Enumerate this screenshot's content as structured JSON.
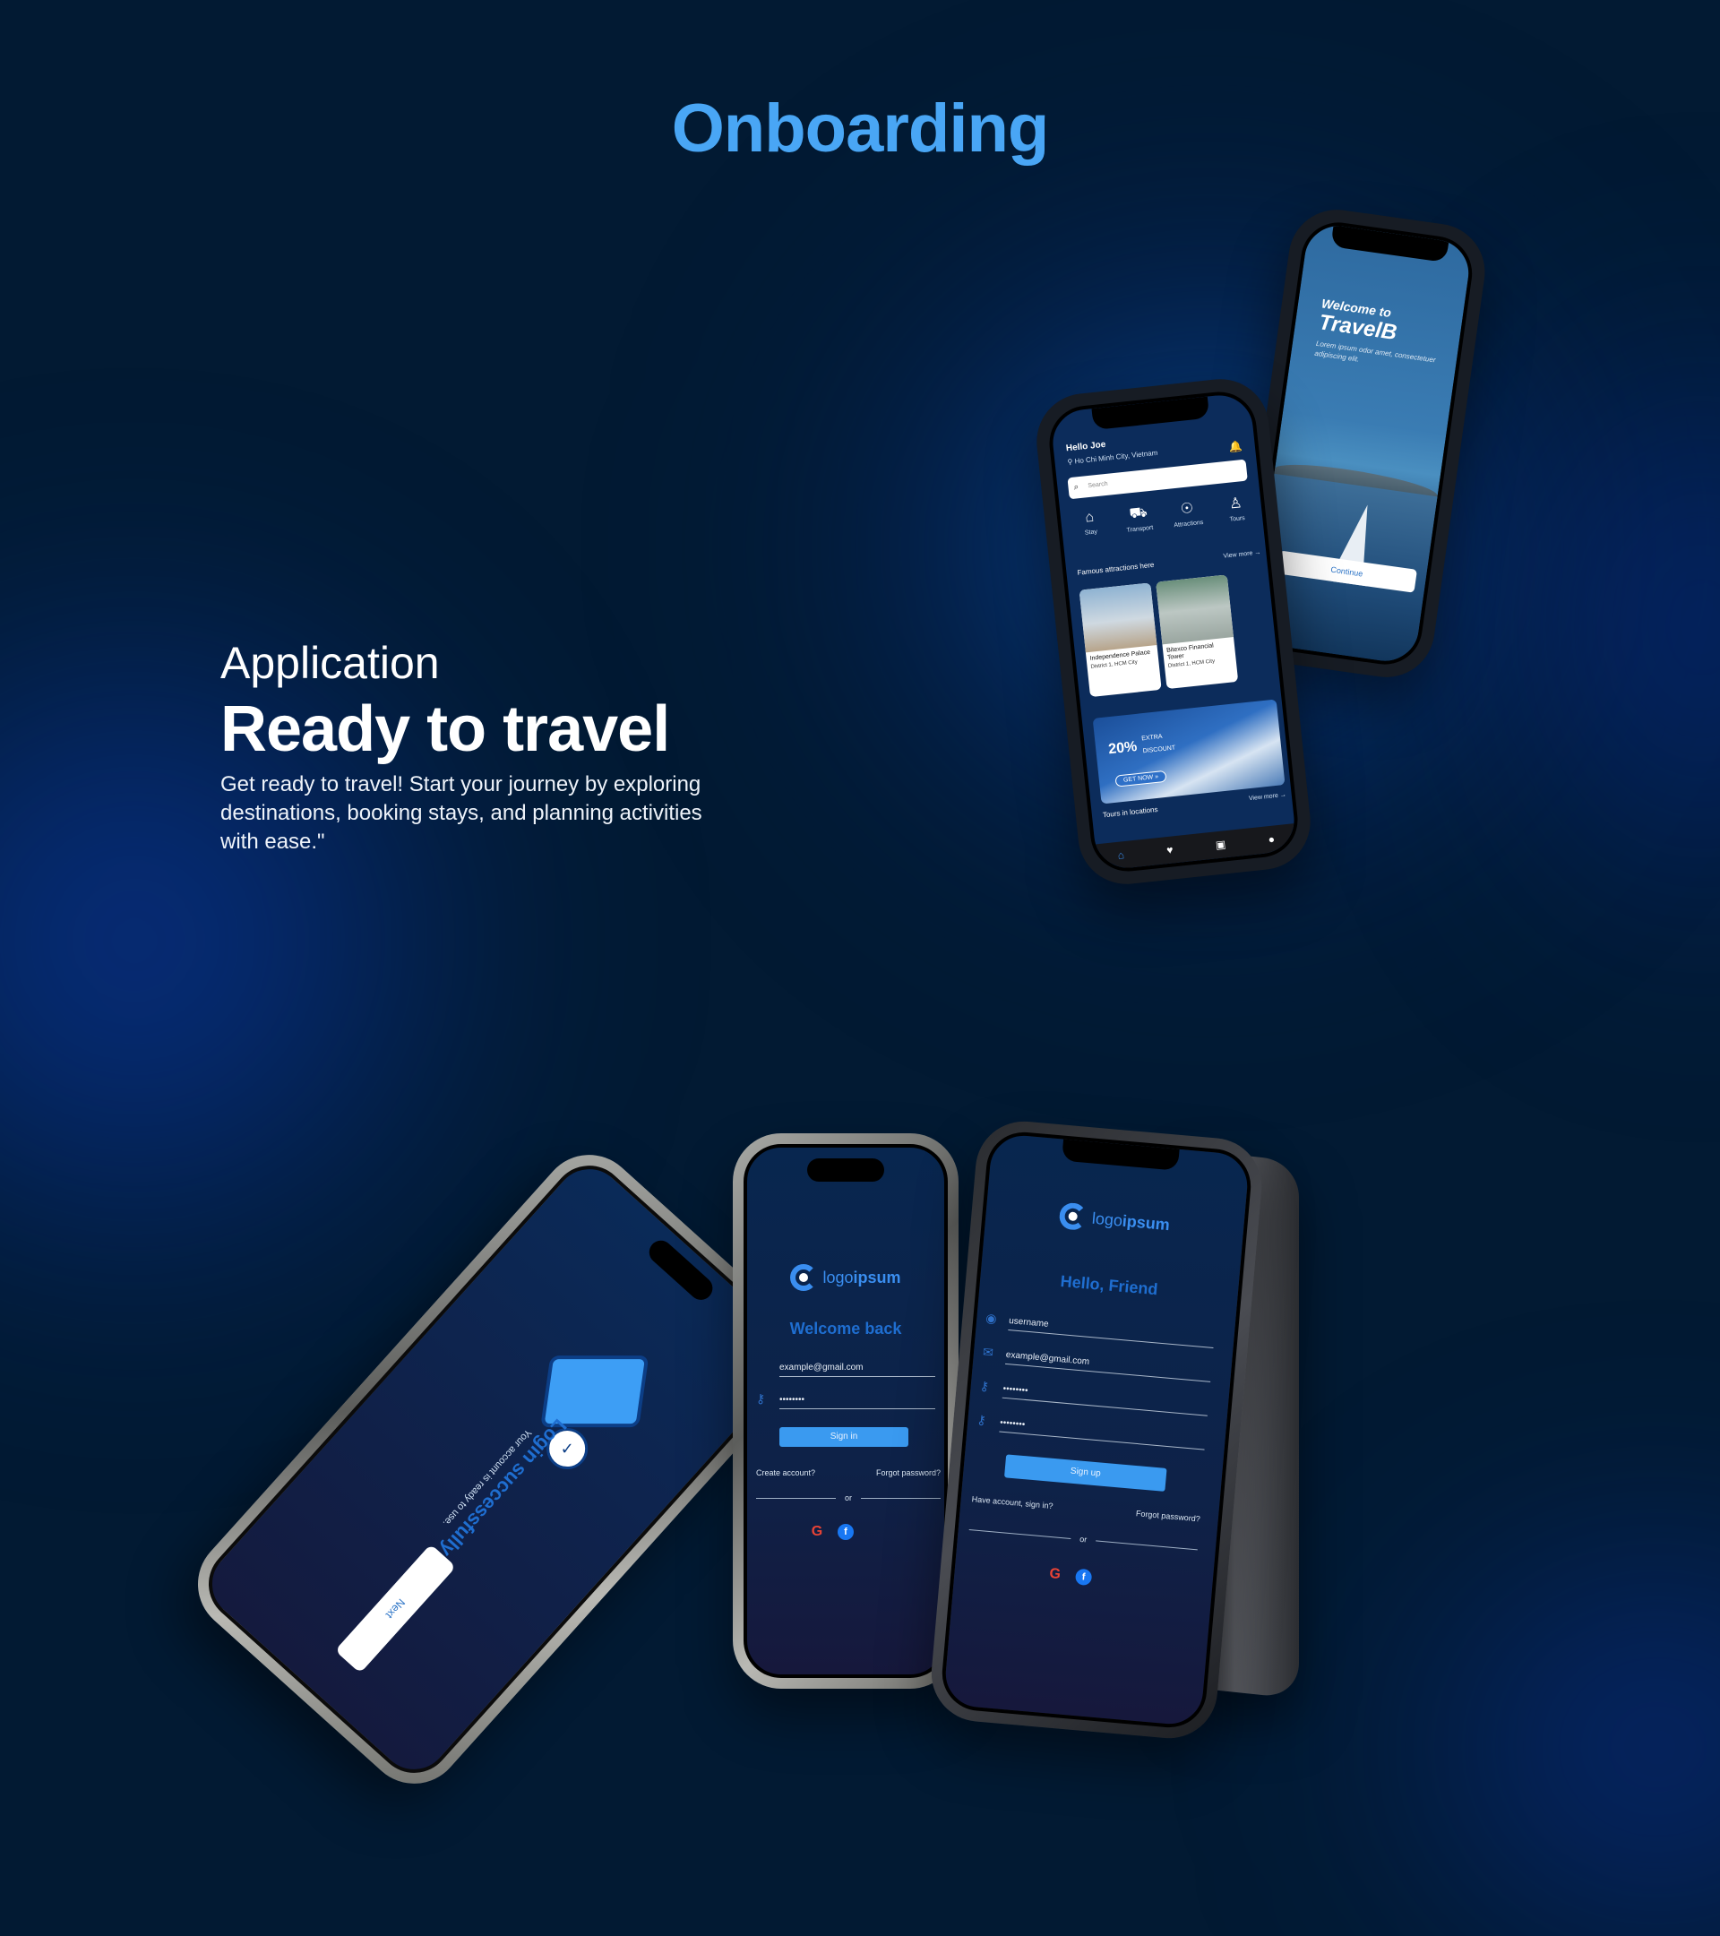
{
  "heading": "Onboarding",
  "intro": {
    "kicker": "Application",
    "title": "Ready to travel",
    "description": "Get ready to travel! Start your journey by exploring destinations, booking stays, and planning activities with ease.\""
  },
  "welcome_screen": {
    "title": "Welcome to",
    "brand": "TravelB",
    "subtitle": "Lorem ipsum odor amet, consectetuer adipiscing elit.",
    "continue_label": "Continue"
  },
  "home_screen": {
    "greeting": "Hello Joe",
    "location": "Ho Chi Minh City, Vietnam",
    "search_placeholder": "Search",
    "categories": [
      "Stay",
      "Transport",
      "Attractions",
      "Tours"
    ],
    "section_attractions": "Famous attractions here",
    "view_more": "View more",
    "cards": [
      {
        "name": "Independence Palace",
        "location": "District 1, HCM City"
      },
      {
        "name": "Bitexco Financial Tower",
        "location": "District 1, HCM City"
      }
    ],
    "promo": {
      "percent": "20%",
      "extra": "EXTRA",
      "discount": "DISCOUNT",
      "cta": "GET NOW"
    },
    "section_tours": "Tours in locations"
  },
  "success_screen": {
    "title": "Login successfully!",
    "subtitle": "Your account is ready to use.",
    "next_label": "Next"
  },
  "login_screen": {
    "logo_a": "logo",
    "logo_b": "ipsum",
    "title": "Welcome back",
    "email_value": "example@gmail.com",
    "password_value": "••••••••",
    "signin_label": "Sign in",
    "create_account": "Create account?",
    "forgot_password": "Forgot password?",
    "or": "or"
  },
  "signup_screen": {
    "logo_a": "logo",
    "logo_b": "ipsum",
    "title": "Hello, Friend",
    "username_value": "username",
    "email_value": "example@gmail.com",
    "password_value": "••••••••",
    "confirm_value": "••••••••",
    "signup_label": "Sign up",
    "have_account": "Have account, sign in?",
    "forgot_password": "Forgot password?",
    "or": "or"
  },
  "colors": {
    "accent": "#49a6f5",
    "background": "#021a33",
    "button": "#3a9af0"
  }
}
